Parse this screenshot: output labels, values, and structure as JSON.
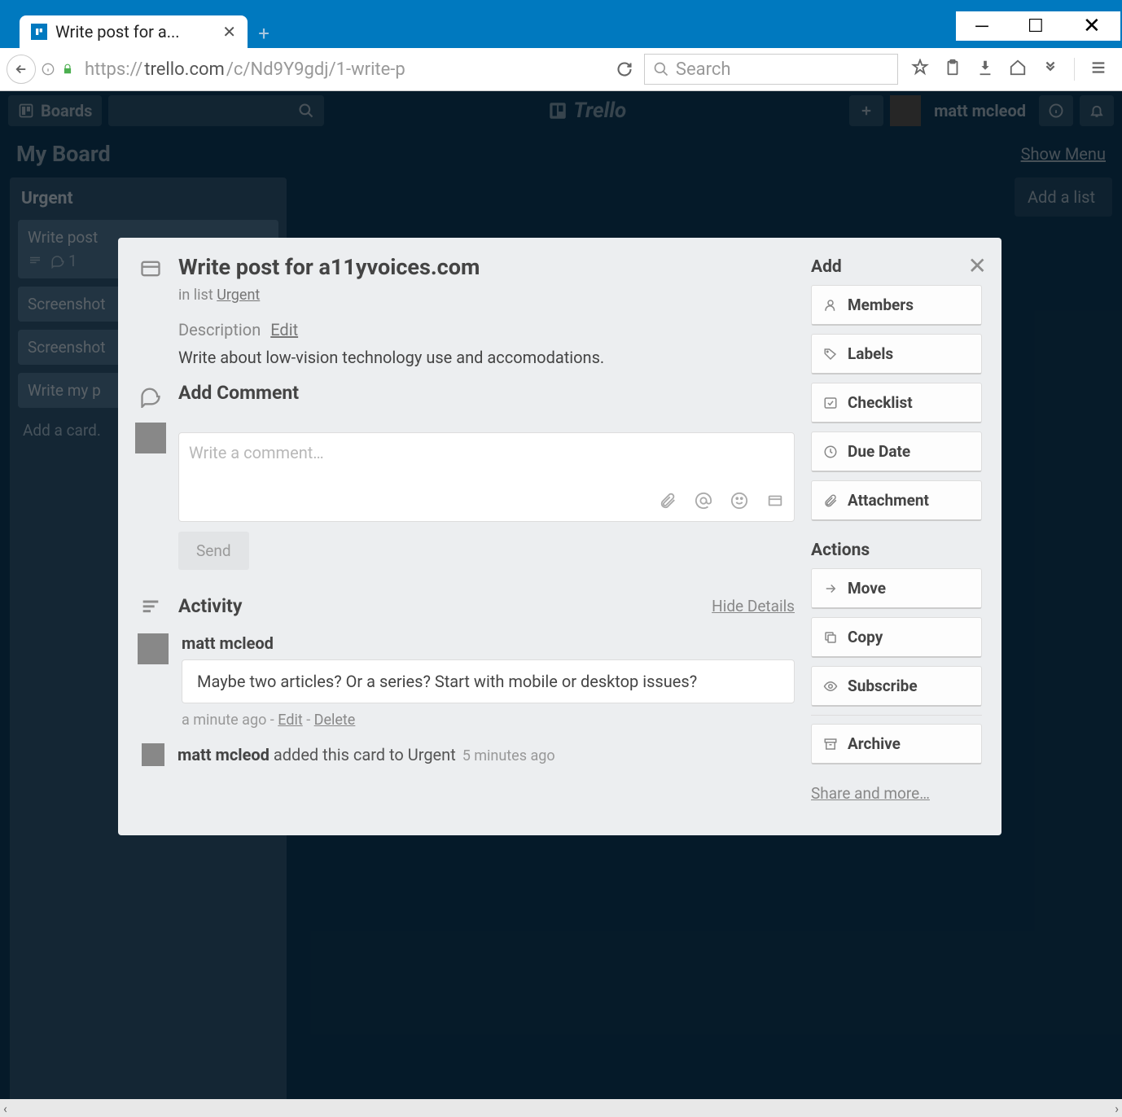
{
  "browser": {
    "tab_title": "Write post for a...",
    "url_protocol": "https://",
    "url_host": "trello.com",
    "url_path": "/c/Nd9Y9gdj/1-write-p",
    "search_placeholder": "Search"
  },
  "trello_header": {
    "boards_btn": "Boards",
    "logo": "Trello",
    "username": "matt mcleod"
  },
  "board_bar": {
    "board_name": "My Board",
    "show_menu": "Show Menu"
  },
  "background_list": {
    "title": "Urgent",
    "cards": [
      {
        "title": "Write post",
        "has_desc": true,
        "comments": "1"
      },
      {
        "title": "Screenshot"
      },
      {
        "title": "Screenshot"
      },
      {
        "title": "Write my p"
      }
    ],
    "add_card": "Add a card.",
    "add_list": "Add a list"
  },
  "card": {
    "title": "Write post for a11yvoices.com",
    "in_list_prefix": "in list ",
    "in_list_name": "Urgent",
    "description_label": "Description",
    "edit_label": "Edit",
    "description_text": "Write about low-vision technology use and accomodations.",
    "add_comment_title": "Add Comment",
    "comment_placeholder": "Write a comment…",
    "send_label": "Send",
    "activity_title": "Activity",
    "hide_details": "Hide Details"
  },
  "activity": {
    "comment": {
      "user": "matt mcleod",
      "text": "Maybe two articles? Or a series? Start with mobile or desktop issues?",
      "time": "a minute ago",
      "edit": "Edit",
      "delete": "Delete"
    },
    "event": {
      "user": "matt mcleod",
      "action": " added this card to Urgent",
      "time": "5 minutes ago"
    }
  },
  "sidebar": {
    "add_title": "Add",
    "add_items": [
      "Members",
      "Labels",
      "Checklist",
      "Due Date",
      "Attachment"
    ],
    "actions_title": "Actions",
    "action_items": [
      "Move",
      "Copy",
      "Subscribe",
      "Archive"
    ],
    "share": "Share and more…"
  }
}
